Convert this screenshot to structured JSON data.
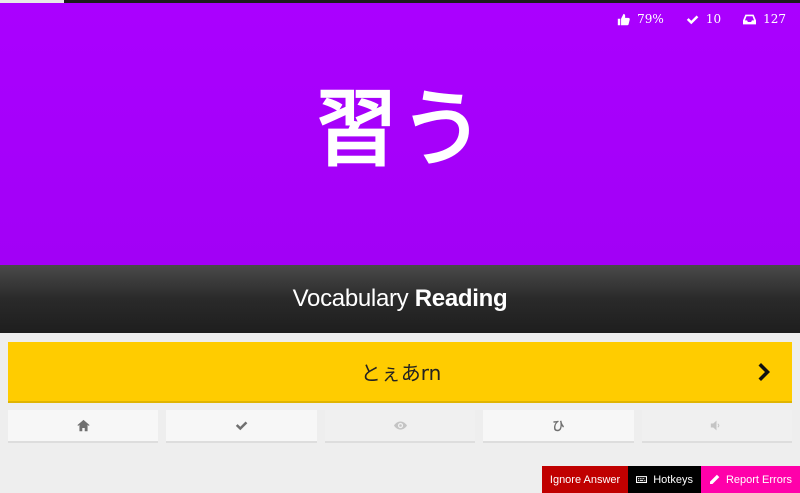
{
  "progress": {
    "fraction": 0.08
  },
  "stats": {
    "percent_correct": "79%",
    "completed": "10",
    "remaining": "127"
  },
  "character": "習う",
  "question": {
    "type": "Vocabulary",
    "category": "Reading",
    "banner_color": "#aa00ff"
  },
  "answer": {
    "value": "とぇあrn",
    "submit_icon": "chevron-right-icon",
    "field_color": "#ffcc00"
  },
  "additional_buttons": [
    {
      "icon": "home-icon"
    },
    {
      "icon": "check-icon"
    },
    {
      "icon": "eye-icon",
      "disabled": true
    },
    {
      "icon": "kana-icon",
      "label": "ひ"
    },
    {
      "icon": "audio-icon",
      "disabled": true
    }
  ],
  "footer": {
    "ignore_answer": "Ignore Answer",
    "hotkeys": "Hotkeys",
    "report_errors": "Report Errors",
    "colors": {
      "ignore": "#c00000",
      "hotkeys": "#000000",
      "report": "#ff00aa"
    }
  }
}
